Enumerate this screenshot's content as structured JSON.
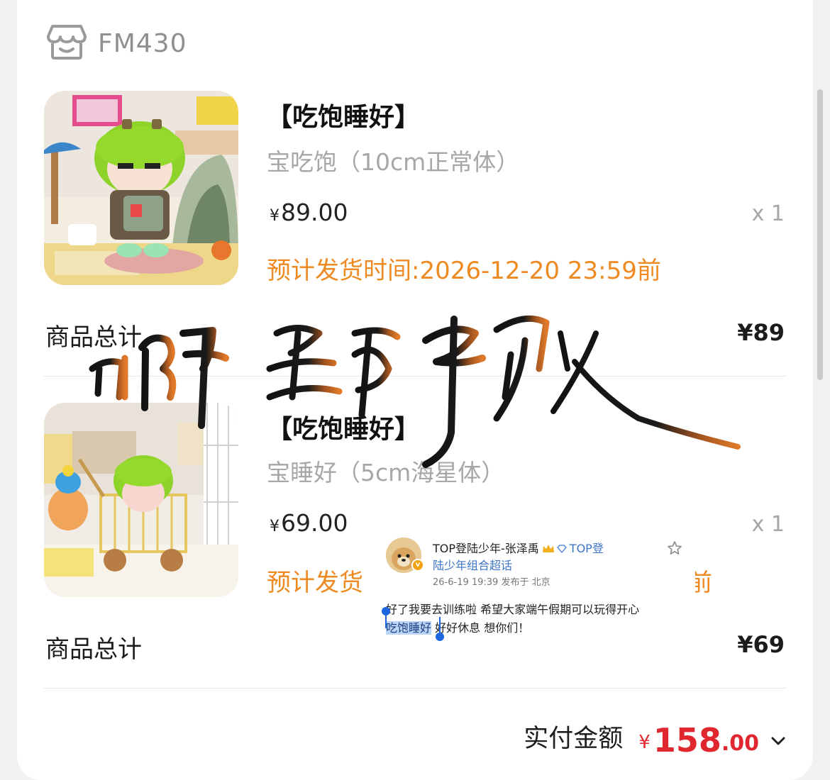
{
  "shop": {
    "name": "FM430",
    "icon": "shop-store-icon"
  },
  "products": [
    {
      "title": "【吃饱睡好】",
      "variant": "宝吃饱（10cm正常体）",
      "price_symbol": "¥",
      "price": "89.00",
      "quantity": "x 1",
      "ship_time": "预计发货时间:2026-12-20 23:59前",
      "subtotal_label": "商品总计",
      "subtotal_value": "¥89",
      "image_desc_icon": "plush-doll-product-image"
    },
    {
      "title": "【吃饱睡好】",
      "variant": "宝睡好（5cm海星体）",
      "price_symbol": "¥",
      "price": "69.00",
      "quantity": "x 1",
      "ship_time_partial": "预计发货",
      "ship_time_tail": "前",
      "subtotal_label": "商品总计",
      "subtotal_value": "¥69",
      "image_desc_icon": "plush-doll-cart-product-image"
    }
  ],
  "payment": {
    "label": "实付金额",
    "symbol": "¥",
    "integer": "158",
    "decimal": ".00"
  },
  "post": {
    "author": "TOP登陆少年-张泽禹",
    "topic_inline": "TOP登",
    "topic_line2": "陆少年组合超话",
    "meta": "26-6-19 19:39  发布于 北京",
    "line1": "好了我要去训练啦 希望大家端午假期可以玩得开心",
    "selected": "吃饱睡好",
    "line2_rest": " 好好休息 想你们！",
    "verified_badge": "v"
  },
  "colors": {
    "accent_orange": "#ee8a22",
    "price_red": "#e0262e",
    "link_blue": "#3c74c6"
  }
}
